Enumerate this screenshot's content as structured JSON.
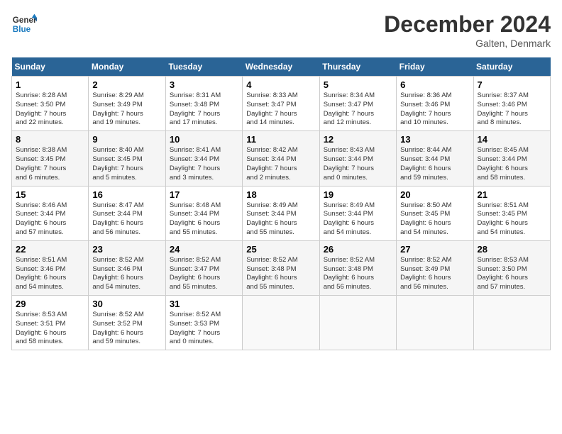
{
  "header": {
    "logo_line1": "General",
    "logo_line2": "Blue",
    "title": "December 2024",
    "location": "Galten, Denmark"
  },
  "columns": [
    "Sunday",
    "Monday",
    "Tuesday",
    "Wednesday",
    "Thursday",
    "Friday",
    "Saturday"
  ],
  "weeks": [
    [
      {
        "day": "1",
        "info": "Sunrise: 8:28 AM\nSunset: 3:50 PM\nDaylight: 7 hours\nand 22 minutes."
      },
      {
        "day": "2",
        "info": "Sunrise: 8:29 AM\nSunset: 3:49 PM\nDaylight: 7 hours\nand 19 minutes."
      },
      {
        "day": "3",
        "info": "Sunrise: 8:31 AM\nSunset: 3:48 PM\nDaylight: 7 hours\nand 17 minutes."
      },
      {
        "day": "4",
        "info": "Sunrise: 8:33 AM\nSunset: 3:47 PM\nDaylight: 7 hours\nand 14 minutes."
      },
      {
        "day": "5",
        "info": "Sunrise: 8:34 AM\nSunset: 3:47 PM\nDaylight: 7 hours\nand 12 minutes."
      },
      {
        "day": "6",
        "info": "Sunrise: 8:36 AM\nSunset: 3:46 PM\nDaylight: 7 hours\nand 10 minutes."
      },
      {
        "day": "7",
        "info": "Sunrise: 8:37 AM\nSunset: 3:46 PM\nDaylight: 7 hours\nand 8 minutes."
      }
    ],
    [
      {
        "day": "8",
        "info": "Sunrise: 8:38 AM\nSunset: 3:45 PM\nDaylight: 7 hours\nand 6 minutes."
      },
      {
        "day": "9",
        "info": "Sunrise: 8:40 AM\nSunset: 3:45 PM\nDaylight: 7 hours\nand 5 minutes."
      },
      {
        "day": "10",
        "info": "Sunrise: 8:41 AM\nSunset: 3:44 PM\nDaylight: 7 hours\nand 3 minutes."
      },
      {
        "day": "11",
        "info": "Sunrise: 8:42 AM\nSunset: 3:44 PM\nDaylight: 7 hours\nand 2 minutes."
      },
      {
        "day": "12",
        "info": "Sunrise: 8:43 AM\nSunset: 3:44 PM\nDaylight: 7 hours\nand 0 minutes."
      },
      {
        "day": "13",
        "info": "Sunrise: 8:44 AM\nSunset: 3:44 PM\nDaylight: 6 hours\nand 59 minutes."
      },
      {
        "day": "14",
        "info": "Sunrise: 8:45 AM\nSunset: 3:44 PM\nDaylight: 6 hours\nand 58 minutes."
      }
    ],
    [
      {
        "day": "15",
        "info": "Sunrise: 8:46 AM\nSunset: 3:44 PM\nDaylight: 6 hours\nand 57 minutes."
      },
      {
        "day": "16",
        "info": "Sunrise: 8:47 AM\nSunset: 3:44 PM\nDaylight: 6 hours\nand 56 minutes."
      },
      {
        "day": "17",
        "info": "Sunrise: 8:48 AM\nSunset: 3:44 PM\nDaylight: 6 hours\nand 55 minutes."
      },
      {
        "day": "18",
        "info": "Sunrise: 8:49 AM\nSunset: 3:44 PM\nDaylight: 6 hours\nand 55 minutes."
      },
      {
        "day": "19",
        "info": "Sunrise: 8:49 AM\nSunset: 3:44 PM\nDaylight: 6 hours\nand 54 minutes."
      },
      {
        "day": "20",
        "info": "Sunrise: 8:50 AM\nSunset: 3:45 PM\nDaylight: 6 hours\nand 54 minutes."
      },
      {
        "day": "21",
        "info": "Sunrise: 8:51 AM\nSunset: 3:45 PM\nDaylight: 6 hours\nand 54 minutes."
      }
    ],
    [
      {
        "day": "22",
        "info": "Sunrise: 8:51 AM\nSunset: 3:46 PM\nDaylight: 6 hours\nand 54 minutes."
      },
      {
        "day": "23",
        "info": "Sunrise: 8:52 AM\nSunset: 3:46 PM\nDaylight: 6 hours\nand 54 minutes."
      },
      {
        "day": "24",
        "info": "Sunrise: 8:52 AM\nSunset: 3:47 PM\nDaylight: 6 hours\nand 55 minutes."
      },
      {
        "day": "25",
        "info": "Sunrise: 8:52 AM\nSunset: 3:48 PM\nDaylight: 6 hours\nand 55 minutes."
      },
      {
        "day": "26",
        "info": "Sunrise: 8:52 AM\nSunset: 3:48 PM\nDaylight: 6 hours\nand 56 minutes."
      },
      {
        "day": "27",
        "info": "Sunrise: 8:52 AM\nSunset: 3:49 PM\nDaylight: 6 hours\nand 56 minutes."
      },
      {
        "day": "28",
        "info": "Sunrise: 8:53 AM\nSunset: 3:50 PM\nDaylight: 6 hours\nand 57 minutes."
      }
    ],
    [
      {
        "day": "29",
        "info": "Sunrise: 8:53 AM\nSunset: 3:51 PM\nDaylight: 6 hours\nand 58 minutes."
      },
      {
        "day": "30",
        "info": "Sunrise: 8:52 AM\nSunset: 3:52 PM\nDaylight: 6 hours\nand 59 minutes."
      },
      {
        "day": "31",
        "info": "Sunrise: 8:52 AM\nSunset: 3:53 PM\nDaylight: 7 hours\nand 0 minutes."
      },
      null,
      null,
      null,
      null
    ]
  ]
}
